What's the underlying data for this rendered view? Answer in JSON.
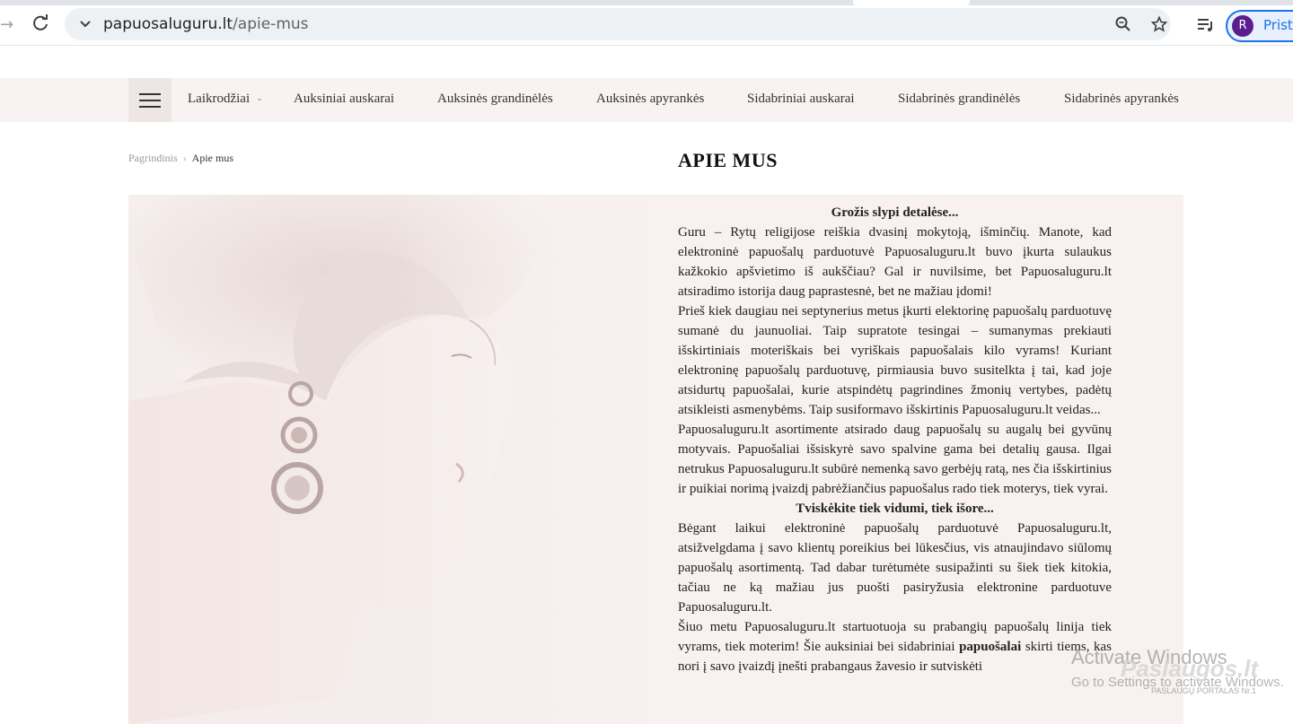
{
  "browser": {
    "url_domain": "papuosaluguru.lt",
    "url_path": "/apie-mus",
    "profile_initial": "R",
    "profile_label": "Prista",
    "accent": "#1a73e8"
  },
  "nav": {
    "items": [
      "Laikrodžiai",
      "Auksiniai auskarai",
      "Auksinės grandinėlės",
      "Auksinės apyrankės",
      "Sidabriniai auskarai",
      "Sidabrinės grandinėlės",
      "Sidabrinės apyrankės"
    ],
    "dropdown_caret": "⌄"
  },
  "breadcrumb": {
    "home": "Pagrindinis",
    "separator": "›",
    "current": "Apie mus"
  },
  "page_title": "APIE MUS",
  "article": {
    "heading1": "Grožis slypi detalėse...",
    "p1": "Guru – Rytų religijose reiškia dvasinį mokytoją, išminčių. Manote, kad elektroninė papuošalų parduotuvė Papuosaluguru.lt buvo įkurta sulaukus kažkokio apšvietimo iš aukščiau? Gal ir nuvilsime, bet Papuosaluguru.lt atsiradimo istorija daug paprastesnė, bet ne mažiau įdomi!",
    "p2": "Prieš kiek daugiau nei septynerius metus įkurti elektorinę papuošalų parduotuvę sumanė du jaunuoliai. Taip supratote tesingai – sumanymas prekiauti išskirtiniais moteriškais bei vyriškais papuošalais kilo vyrams! Kuriant elektroninę papuošalų parduotuvę, pirmiausia buvo susitelkta į tai, kad joje atsidurtų papuošalai, kurie atspindėtų pagrindines žmonių vertybes, padėtų atsikleisti asmenybėms. Taip susiformavo išskirtinis Papuosaluguru.lt veidas...",
    "p3": "Papuosaluguru.lt asortimente atsirado daug papuošalų su augalų bei gyvūnų motyvais. Papuošaliai išsiskyrė savo spalvine gama bei detalių gausa. Ilgai netrukus Papuosaluguru.lt subūrė nemenką savo gerbėjų ratą, nes čia išskirtinius ir puikiai norimą įvaizdį pabrėžiančius papuošalus rado tiek moterys, tiek vyrai.",
    "heading2": "Tviskėkite tiek vidumi, tiek išore...",
    "p4": "Bėgant laikui elektroninė papuošalų parduotuvė Papuosaluguru.lt, atsižvelgdama į savo klientų poreikius bei lūkesčius, vis atnaujindavo siūlomų papuošalų asortimentą. Tad dabar turėtumėte susipažinti su šiek tiek kitokia, tačiau ne ką mažiau jus puošti pasiryžusia elektronine parduotuve Papuosaluguru.lt.",
    "p5a": "Šiuo metu Papuosaluguru.lt startuotuoja su prabangių papuošalų linija tiek vyrams, tiek moterim! Šie auksiniai bei sidabriniai ",
    "p5bold": "papuošalai",
    "p5b": " skirti tiems, kas nori į savo įvaizdį įnešti prabangaus žavesio ir sutviskėti"
  },
  "overlay": {
    "activate_title": "Activate Windows",
    "activate_sub": "Go to Settings to activate Windows.",
    "stamp": "Paslaugos.lt",
    "stamp_sub": "PASLAUGŲ PORTALAS  Nr.1"
  }
}
